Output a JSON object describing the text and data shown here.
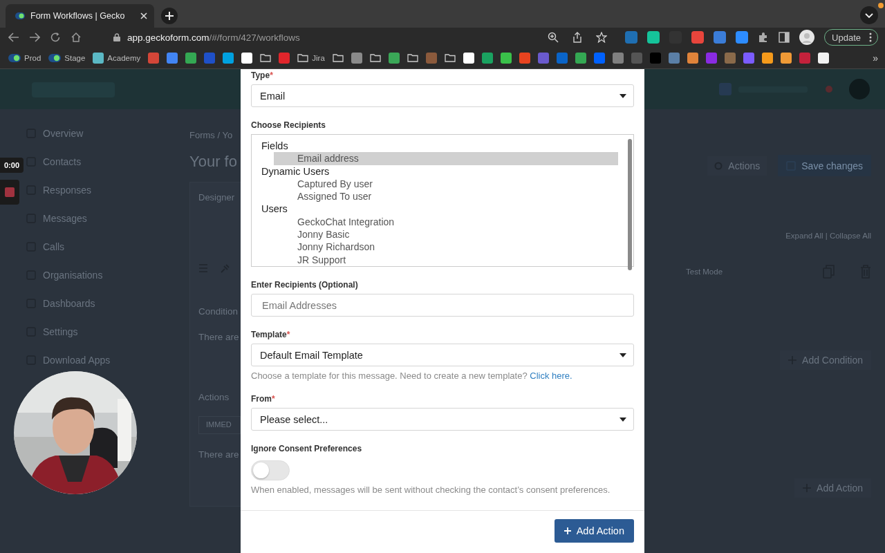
{
  "browser": {
    "tab": {
      "title": "Form Workflows | Gecko",
      "selected": true
    },
    "url_host": "app.geckoform.com",
    "url_path": "/#/form/427/workflows",
    "update_button": "Update",
    "extensions": [
      {
        "color": "#1f6fb2"
      },
      {
        "color": "#15c39a"
      },
      {
        "color": "#333333"
      },
      {
        "color": "#e8453c"
      },
      {
        "color": "#3b7dd8"
      },
      {
        "color": "#2d8cff"
      }
    ],
    "bookmarks": [
      {
        "kind": "site",
        "label": "Prod"
      },
      {
        "kind": "site",
        "label": "Stage"
      },
      {
        "kind": "app",
        "label": "Academy",
        "color": "#5bb8c4"
      },
      {
        "kind": "app",
        "color": "#d44638"
      },
      {
        "kind": "app",
        "color": "#4285f4"
      },
      {
        "kind": "app",
        "color": "#34a853"
      },
      {
        "kind": "app",
        "color": "#1f50c8"
      },
      {
        "kind": "app",
        "color": "#00a1e0"
      },
      {
        "kind": "app",
        "color": "#ffffff"
      },
      {
        "kind": "folder"
      },
      {
        "kind": "app",
        "color": "#e0252b"
      },
      {
        "kind": "folder",
        "label": "Jira"
      },
      {
        "kind": "folder"
      },
      {
        "kind": "app",
        "color": "#8a8a8a"
      },
      {
        "kind": "folder"
      },
      {
        "kind": "app",
        "color": "#3aa757"
      },
      {
        "kind": "folder"
      },
      {
        "kind": "app",
        "color": "#8b5a3c"
      },
      {
        "kind": "folder"
      },
      {
        "kind": "app",
        "color": "#ffffff"
      },
      {
        "kind": "app",
        "color": "#1aa260"
      },
      {
        "kind": "app",
        "color": "#3ac14a"
      },
      {
        "kind": "app",
        "color": "#e8431f"
      },
      {
        "kind": "app",
        "color": "#6a5acd"
      },
      {
        "kind": "app",
        "color": "#0a64c8"
      },
      {
        "kind": "app",
        "color": "#34a853"
      },
      {
        "kind": "app",
        "color": "#0061fe"
      },
      {
        "kind": "app",
        "color": "#808080"
      },
      {
        "kind": "app",
        "color": "#555555"
      },
      {
        "kind": "app",
        "color": "#000000"
      },
      {
        "kind": "app",
        "color": "#5b7fa6"
      },
      {
        "kind": "app",
        "color": "#e0833a"
      },
      {
        "kind": "app",
        "color": "#8a2be2"
      },
      {
        "kind": "app",
        "color": "#8a6a4a"
      },
      {
        "kind": "app",
        "color": "#7b5cff"
      },
      {
        "kind": "app",
        "color": "#f59a1b"
      },
      {
        "kind": "app",
        "color": "#f09a36"
      },
      {
        "kind": "app",
        "color": "#c4213b"
      },
      {
        "kind": "app",
        "color": "#f2f2f2"
      }
    ],
    "more": "»"
  },
  "recorder": {
    "time": "0:00"
  },
  "app": {
    "sidebar": {
      "items": [
        {
          "label": "Overview"
        },
        {
          "label": "Contacts"
        },
        {
          "label": "Responses"
        },
        {
          "label": "Messages"
        },
        {
          "label": "Calls"
        },
        {
          "label": "Organisations"
        },
        {
          "label": "Dashboards"
        },
        {
          "label": "Settings"
        },
        {
          "label": "Download Apps"
        }
      ]
    },
    "breadcrumb": "Forms / Yo",
    "title": "Your fo",
    "tab": "Designer",
    "conditions_heading": "Condition",
    "conditions_empty": "There are",
    "actions_heading": "Actions",
    "trigger_button": "IMMED",
    "actions_empty": "There are",
    "actions_menu": "Actions",
    "save_button": "Save changes",
    "expand_collapse": "Expand All | Collapse All",
    "test_mode": "Test Mode",
    "add_condition": "Add Condition",
    "add_action": "Add Action"
  },
  "modal": {
    "fields": [
      {
        "kind": "select",
        "label": "Type",
        "required_mark": "*",
        "value": "Email"
      },
      {
        "kind": "listbox",
        "label": "Choose Recipients",
        "groups": [
          {
            "label": "Fields",
            "children": [
              {
                "label": "Email address",
                "selected": true
              }
            ]
          },
          {
            "label": "Dynamic Users",
            "children": [
              {
                "label": "Captured By user",
                "selected": false
              },
              {
                "label": "Assigned To user",
                "selected": false
              }
            ]
          },
          {
            "label": "Users",
            "children": [
              {
                "label": "GeckoChat Integration",
                "selected": false
              },
              {
                "label": "Jonny Basic",
                "selected": false
              },
              {
                "label": "Jonny Richardson",
                "selected": false
              },
              {
                "label": "JR Support",
                "selected": false
              }
            ]
          }
        ]
      },
      {
        "kind": "input",
        "label": "Enter Recipients (Optional)",
        "placeholder": "Email Addresses"
      },
      {
        "kind": "select",
        "label": "Template",
        "required_mark": "*",
        "value": "Default Email Template",
        "help": "Choose a template for this message. Need to create a new template?",
        "help_link": "Click here."
      },
      {
        "kind": "select",
        "label": "From",
        "required_mark": "*",
        "value": "Please select..."
      },
      {
        "kind": "toggle",
        "label": "Ignore Consent Preferences",
        "on": false,
        "help": "When enabled, messages will be sent without checking the contact’s consent preferences."
      }
    ],
    "add_action_button": "Add Action"
  }
}
